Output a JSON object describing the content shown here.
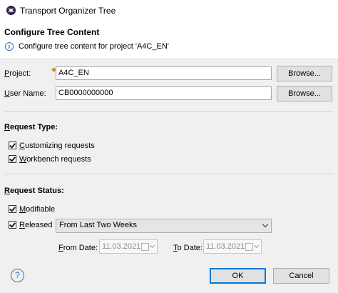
{
  "window": {
    "title": "Transport Organizer Tree"
  },
  "header": {
    "title": "Configure Tree Content",
    "info_text": "Configure tree content for project 'A4C_EN'"
  },
  "form": {
    "project_label_u": "P",
    "project_label_rest": "roject:",
    "project_value": "A4C_EN",
    "project_browse": "Browse...",
    "user_label_u": "U",
    "user_label_rest": "ser Name:",
    "user_value": "CB0000000000",
    "user_browse": "Browse..."
  },
  "request_type": {
    "heading_u": "R",
    "heading_rest": "equest Type:",
    "customizing_u": "C",
    "customizing_rest": "ustomizing requests",
    "customizing_checked": true,
    "workbench_u": "W",
    "workbench_rest": "orkbench requests",
    "workbench_checked": true
  },
  "request_status": {
    "heading_u": "R",
    "heading_rest": "equest Status:",
    "modifiable_u": "M",
    "modifiable_rest": "odifiable",
    "modifiable_checked": true,
    "released_u": "R",
    "released_rest": "eleased",
    "released_checked": true,
    "range_selected": "From Last Two Weeks",
    "from_label_u": "F",
    "from_label_rest": "rom Date:",
    "from_value": "11.03.2021",
    "to_label_u": "T",
    "to_label_rest": "o Date:",
    "to_value": "11.03.2021"
  },
  "footer": {
    "ok_label": "OK",
    "cancel_label": "Cancel",
    "help_glyph": "?"
  },
  "icons": {
    "app": "eclipse-icon",
    "info": "info-icon",
    "help": "help-icon",
    "decoration": "content-assist-icon"
  },
  "colors": {
    "background": "#f0f0f0",
    "accent": "#0078d7",
    "info_blue": "#3b6fb6"
  }
}
